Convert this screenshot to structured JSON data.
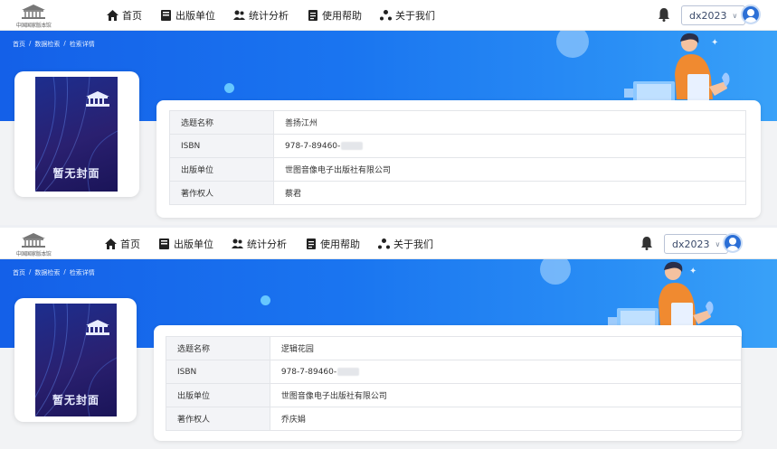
{
  "logo": {
    "text": "中国国家版本馆"
  },
  "nav": {
    "items": [
      {
        "label": "首页",
        "icon": "home-icon"
      },
      {
        "label": "出版单位",
        "icon": "book-icon"
      },
      {
        "label": "统计分析",
        "icon": "users-icon"
      },
      {
        "label": "使用帮助",
        "icon": "document-icon"
      },
      {
        "label": "关于我们",
        "icon": "share-icon"
      }
    ],
    "username": "dx2023"
  },
  "breadcrumb": [
    "首页",
    "/",
    "数据检索",
    "/",
    "检索详情"
  ],
  "cover": {
    "placeholder": "暂无封面"
  },
  "fields": [
    "选题名称",
    "ISBN",
    "出版单位",
    "著作权人"
  ],
  "records": [
    {
      "title": "善扬江州",
      "isbn": "978-7-89460-",
      "publisher": "世图音像电子出版社有限公司",
      "copyright_holder": "蔡君"
    },
    {
      "title": "逻辑花园",
      "isbn": "978-7-89460-",
      "publisher": "世图音像电子出版社有限公司",
      "copyright_holder": "乔庆娟"
    }
  ],
  "colors": {
    "banner": "#1a75f0",
    "accent": "#f08a30",
    "cover": "#2a2070"
  }
}
